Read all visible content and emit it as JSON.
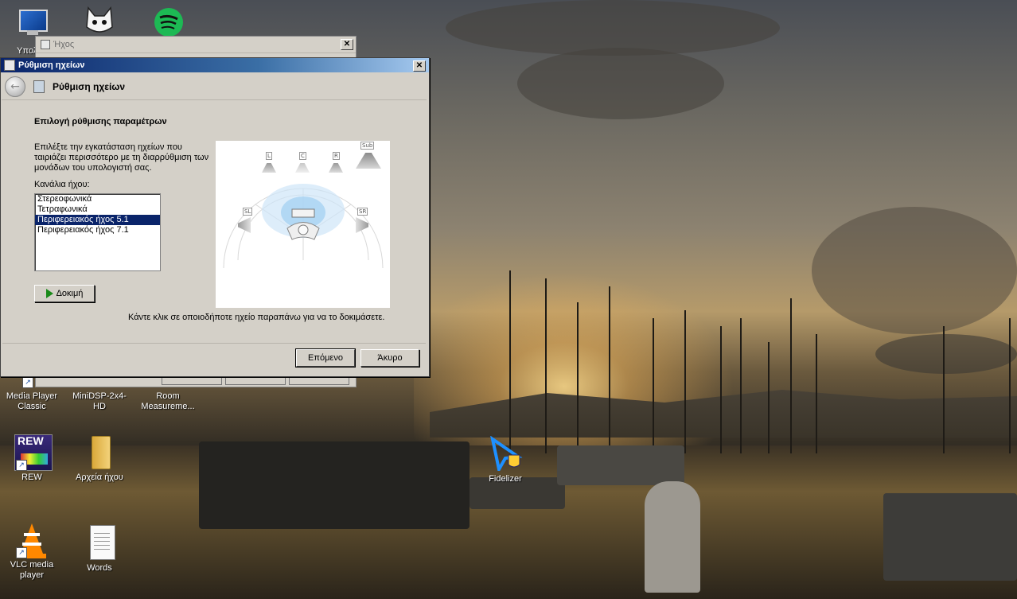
{
  "desktop": {
    "icons": [
      {
        "label": "Υπολογ",
        "icon": "computer-icon"
      },
      {
        "label": "",
        "icon": "cat-app-icon"
      },
      {
        "label": "",
        "icon": "spotify-icon"
      },
      {
        "label": "Media Player Classic",
        "icon": "media-player-icon"
      },
      {
        "label": "MiniDSP-2x4-HD",
        "icon": "minidsp-icon"
      },
      {
        "label": "Room Measureme...",
        "icon": "room-measurement-icon"
      },
      {
        "label": "REW",
        "icon": "rew-icon"
      },
      {
        "label": "Αρχεία ήχου",
        "icon": "folder-icon"
      },
      {
        "label": "Fidelizer",
        "icon": "fidelizer-icon"
      },
      {
        "label": "VLC media player",
        "icon": "vlc-icon"
      },
      {
        "label": "Words",
        "icon": "document-icon"
      }
    ]
  },
  "back_window": {
    "title": "Ήχος"
  },
  "window": {
    "title": "Ρύθμιση ηχείων",
    "nav_title": "Ρύθμιση ηχείων",
    "heading": "Επιλογή ρύθμισης παραμέτρων",
    "description": "Επιλέξτε την εγκατάσταση ηχείων που ταιριάζει περισσότερο με τη διαρρύθμιση των μονάδων του υπολογιστή σας.",
    "channels_label": "Κανάλια ήχου:",
    "channels": [
      "Στερεοφωνικά",
      "Τετραφωνικά",
      "Περιφερειακός ήχος 5.1",
      "Περιφερειακός ήχος 7.1"
    ],
    "selected_channel": "Περιφερειακός ήχος 5.1",
    "test_button": "Δοκιμή",
    "hint": "Κάντε κλικ σε οποιοδήποτε ηχείο παραπάνω για να το δοκιμάσετε.",
    "next_button": "Επόμενο",
    "cancel_button": "Άκυρο",
    "speakers": [
      "L",
      "C",
      "R",
      "Sub",
      "SL",
      "SR"
    ]
  }
}
